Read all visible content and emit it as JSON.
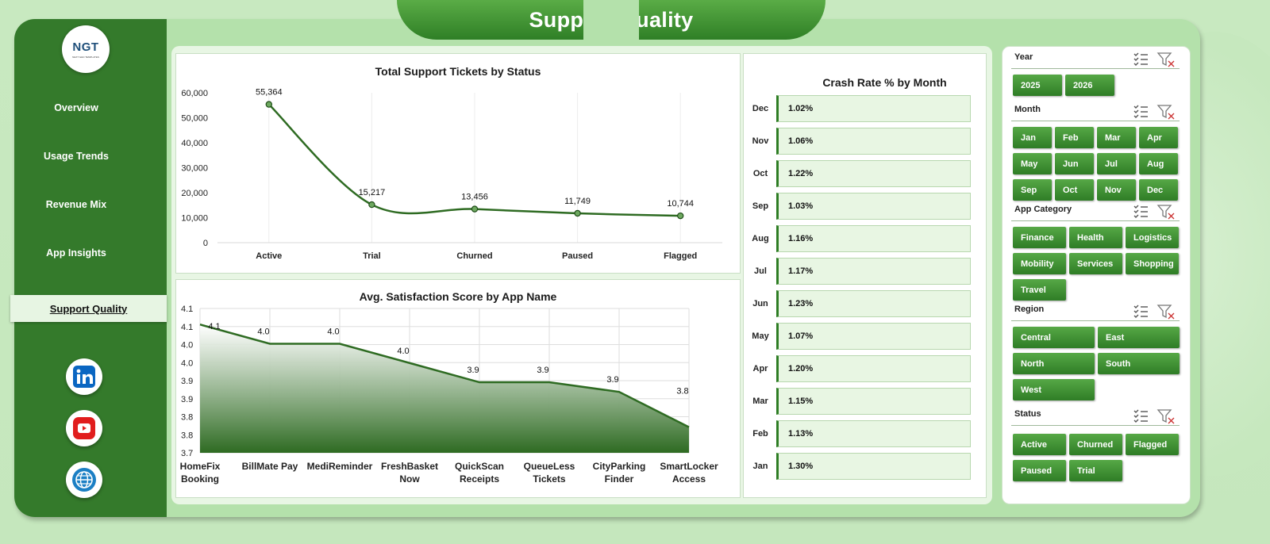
{
  "page": {
    "title": "Support Quality"
  },
  "sidebar": {
    "logo_text": "NGT",
    "logo_subtext": "NEXT GEN TEMPLATES",
    "items": [
      {
        "label": "Overview"
      },
      {
        "label": "Usage Trends"
      },
      {
        "label": "Revenue Mix"
      },
      {
        "label": "App Insights"
      },
      {
        "label": "Support Quality",
        "active": true
      }
    ],
    "social": [
      {
        "icon": "linkedin-icon",
        "color": "#0a66c2"
      },
      {
        "icon": "youtube-icon",
        "color": "#e11d1d"
      },
      {
        "icon": "globe-icon",
        "color": "#1b7fc4"
      }
    ]
  },
  "charts": {
    "tickets": {
      "title": "Total Support Tickets by Status",
      "type": "line",
      "categories": [
        "Active",
        "Trial",
        "Churned",
        "Paused",
        "Flagged"
      ],
      "values": [
        55364,
        15217,
        13456,
        11749,
        10744
      ],
      "value_labels": [
        "55,364",
        "15,217",
        "13,456",
        "11,749",
        "10,744"
      ],
      "y_ticks": [
        "0",
        "10,000",
        "20,000",
        "30,000",
        "40,000",
        "50,000",
        "60,000"
      ],
      "ylim": [
        0,
        60000
      ],
      "color": "#2e6b22"
    },
    "satisfaction": {
      "title": "Avg. Satisfaction Score by App Name",
      "type": "area",
      "categories": [
        "HomeFix Booking",
        "BillMate Pay",
        "MediReminder",
        "FreshBasket Now",
        "QuickScan Receipts",
        "QueueLess Tickets",
        "CityParking Finder",
        "SmartLocker Access"
      ],
      "category_lines": [
        [
          "HomeFix",
          "Booking"
        ],
        [
          "BillMate Pay"
        ],
        [
          "MediReminder"
        ],
        [
          "FreshBasket",
          "Now"
        ],
        [
          "QuickScan",
          "Receipts"
        ],
        [
          "QueueLess",
          "Tickets"
        ],
        [
          "CityParking",
          "Finder"
        ],
        [
          "SmartLocker",
          "Access"
        ]
      ],
      "values": [
        4.1,
        4.04,
        4.04,
        3.98,
        3.92,
        3.92,
        3.89,
        3.78
      ],
      "value_labels": [
        "4.1",
        "4.0",
        "4.0",
        "4.0",
        "3.9",
        "3.9",
        "3.9",
        "3.8"
      ],
      "y_ticks": [
        "3.7",
        "3.8",
        "3.8",
        "3.9",
        "3.9",
        "4.0",
        "4.0",
        "4.1",
        "4.1"
      ],
      "ylim": [
        3.7,
        4.15
      ],
      "color": "#2e6b22"
    },
    "crash": {
      "title": "Crash Rate % by Month",
      "type": "bar",
      "months": [
        "Dec",
        "Nov",
        "Oct",
        "Sep",
        "Aug",
        "Jul",
        "Jun",
        "May",
        "Apr",
        "Mar",
        "Feb",
        "Jan"
      ],
      "values": [
        "1.02%",
        "1.06%",
        "1.22%",
        "1.03%",
        "1.16%",
        "1.17%",
        "1.23%",
        "1.07%",
        "1.20%",
        "1.15%",
        "1.13%",
        "1.30%"
      ]
    }
  },
  "chart_data": [
    {
      "type": "line",
      "title": "Total Support Tickets by Status",
      "categories": [
        "Active",
        "Trial",
        "Churned",
        "Paused",
        "Flagged"
      ],
      "values": [
        55364,
        15217,
        13456,
        11749,
        10744
      ],
      "ylim": [
        0,
        60000
      ]
    },
    {
      "type": "area",
      "title": "Avg. Satisfaction Score by App Name",
      "categories": [
        "HomeFix Booking",
        "BillMate Pay",
        "MediReminder",
        "FreshBasket Now",
        "QuickScan Receipts",
        "QueueLess Tickets",
        "CityParking Finder",
        "SmartLocker Access"
      ],
      "values": [
        4.1,
        4.04,
        4.04,
        3.98,
        3.92,
        3.92,
        3.89,
        3.78
      ],
      "ylim": [
        3.7,
        4.15
      ]
    },
    {
      "type": "bar",
      "title": "Crash Rate % by Month",
      "categories": [
        "Dec",
        "Nov",
        "Oct",
        "Sep",
        "Aug",
        "Jul",
        "Jun",
        "May",
        "Apr",
        "Mar",
        "Feb",
        "Jan"
      ],
      "values": [
        1.02,
        1.06,
        1.22,
        1.03,
        1.16,
        1.17,
        1.23,
        1.07,
        1.2,
        1.15,
        1.13,
        1.3
      ]
    }
  ],
  "filters": {
    "year": {
      "title": "Year",
      "options": [
        "2025",
        "2026"
      ]
    },
    "month": {
      "title": "Month",
      "options": [
        "Jan",
        "Feb",
        "Mar",
        "Apr",
        "May",
        "Jun",
        "Jul",
        "Aug",
        "Sep",
        "Oct",
        "Nov",
        "Dec"
      ]
    },
    "app_category": {
      "title": "App Category",
      "options": [
        "Finance",
        "Health",
        "Logistics",
        "Mobility",
        "Services",
        "Shopping",
        "Travel"
      ]
    },
    "region": {
      "title": "Region",
      "options": [
        "Central",
        "East",
        "North",
        "South",
        "West"
      ]
    },
    "status": {
      "title": "Status",
      "options": [
        "Active",
        "Churned",
        "Flagged",
        "Paused",
        "Trial"
      ]
    }
  },
  "colors": {
    "primary": "#347a2b",
    "light": "#b4e1ab",
    "accent": "#2e6b22"
  }
}
